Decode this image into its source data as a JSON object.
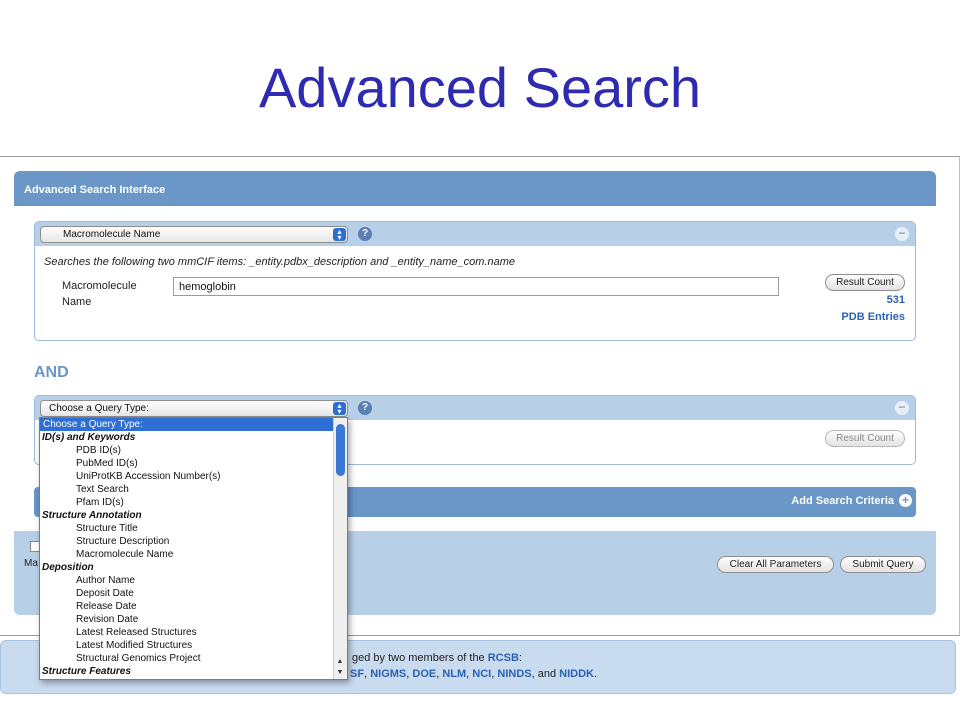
{
  "slide": {
    "title": "Advanced Search"
  },
  "panel": {
    "header": "Advanced Search Interface"
  },
  "criteria1": {
    "select_value": "Macromolecule Name",
    "description": "Searches the following two mmCIF items: _entity.pdbx_description and _entity_name_com.name",
    "field_label_line1": "Macromolecule",
    "field_label_line2": "Name",
    "input_value": "hemoglobin",
    "result_count_button": "Result Count",
    "count": "531",
    "count_unit": "PDB Entries"
  },
  "and_label": "AND",
  "criteria2": {
    "select_value": "Choose a Query Type:",
    "result_count_button": "Result Count"
  },
  "add_criteria": {
    "label": "Add Search Criteria"
  },
  "footer": {
    "partial_label": "Ma",
    "clear_button": "Clear All Parameters",
    "submit_button": "Submit Query"
  },
  "bottom": {
    "line1_prefix": "ged by two members of the ",
    "line1_link": "RCSB",
    "line1_suffix": ":",
    "line2_links": [
      "SF",
      "NIGMS",
      "DOE",
      "NLM",
      "NCI",
      "NINDS"
    ],
    "line2_last": "NIDDK",
    "line2_and": ", and ",
    "line2_end": "."
  },
  "dropdown": {
    "options": [
      {
        "label": "Choose a Query Type:",
        "kind": "selected"
      },
      {
        "label": "ID(s) and Keywords",
        "kind": "group"
      },
      {
        "label": "PDB ID(s)",
        "kind": "item"
      },
      {
        "label": "PubMed ID(s)",
        "kind": "item"
      },
      {
        "label": "UniProtKB Accession Number(s)",
        "kind": "item"
      },
      {
        "label": "Text Search",
        "kind": "item"
      },
      {
        "label": "Pfam ID(s)",
        "kind": "item"
      },
      {
        "label": "Structure Annotation",
        "kind": "group"
      },
      {
        "label": "Structure Title",
        "kind": "item"
      },
      {
        "label": "Structure Description",
        "kind": "item"
      },
      {
        "label": "Macromolecule Name",
        "kind": "item"
      },
      {
        "label": "Deposition",
        "kind": "group"
      },
      {
        "label": "Author Name",
        "kind": "item"
      },
      {
        "label": "Deposit Date",
        "kind": "item"
      },
      {
        "label": "Release Date",
        "kind": "item"
      },
      {
        "label": "Revision Date",
        "kind": "item"
      },
      {
        "label": "Latest Released Structures",
        "kind": "item"
      },
      {
        "label": "Latest Modified Structures",
        "kind": "item"
      },
      {
        "label": "Structural Genomics Project",
        "kind": "item"
      },
      {
        "label": "Structure Features",
        "kind": "group"
      }
    ]
  },
  "colors": {
    "title": "#2e2bb0",
    "header": "#6a96c8",
    "link": "#2b62b3",
    "selected": "#2f6ed3"
  }
}
